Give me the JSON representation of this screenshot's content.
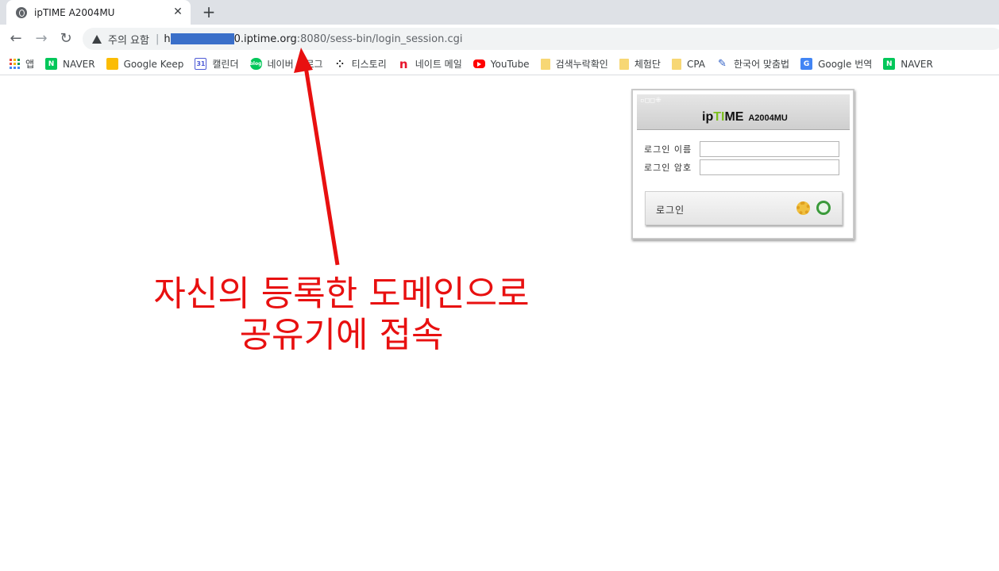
{
  "tab": {
    "title": "ipTIME A2004MU",
    "close": "✕",
    "new": "+"
  },
  "nav": {
    "back": "←",
    "forward": "→",
    "reload": "↻"
  },
  "omnibox": {
    "warning": "주의 요함",
    "separator": "|",
    "url_prefix": "h",
    "url_host": "0.iptime.org",
    "url_path": ":8080/sess-bin/login_session.cgi"
  },
  "bookmarks": [
    {
      "label": "앱",
      "icon": "apps-icon"
    },
    {
      "label": "NAVER",
      "icon": "naver-icon",
      "glyph": "N"
    },
    {
      "label": "Google Keep",
      "icon": "keep-icon",
      "glyph": ""
    },
    {
      "label": "캘린더",
      "icon": "calendar-icon",
      "glyph": "31"
    },
    {
      "label": "네이버 블로그",
      "icon": "blog-icon",
      "glyph": "blog"
    },
    {
      "label": "티스토리",
      "icon": "tistory-icon",
      "glyph": "⁘"
    },
    {
      "label": "네이트 메일",
      "icon": "nate-icon",
      "glyph": "n"
    },
    {
      "label": "YouTube",
      "icon": "youtube-icon",
      "glyph": ""
    },
    {
      "label": "검색누락확인",
      "icon": "folder-icon",
      "glyph": ""
    },
    {
      "label": "체험단",
      "icon": "folder-icon",
      "glyph": ""
    },
    {
      "label": "CPA",
      "icon": "folder-icon",
      "glyph": ""
    },
    {
      "label": "한국어 맞춤법",
      "icon": "dictionary-icon",
      "glyph": "✎"
    },
    {
      "label": "Google 번역",
      "icon": "translate-icon",
      "glyph": "G"
    },
    {
      "label": "NAVER",
      "icon": "naver-icon",
      "glyph": "N"
    }
  ],
  "login": {
    "brand_ip": "ip",
    "brand_ti": "TI",
    "brand_me": "ME",
    "model": "A2004MU",
    "username_label": "로그인 이름",
    "password_label": "로그인 암호",
    "username_value": "",
    "password_value": "",
    "button_label": "로그인"
  },
  "annotation": {
    "line1": "자신의 등록한 도메인으로",
    "line2": "공유기에 접속",
    "color": "#e81010"
  }
}
